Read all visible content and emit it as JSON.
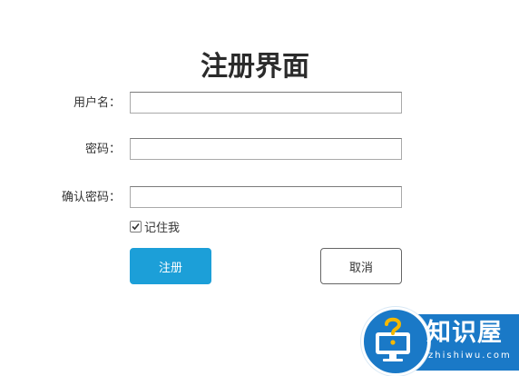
{
  "form": {
    "title": "注册界面",
    "username_label": "用户名：",
    "password_label": "密码：",
    "confirm_label": "确认密码：",
    "username_value": "",
    "password_value": "",
    "confirm_value": "",
    "remember_label": "记住我",
    "remember_checked": true,
    "register_button": "注册",
    "cancel_button": "取消"
  },
  "watermark": {
    "brand": "知识屋",
    "url": "zhishiwu.com",
    "icon": "computer-question-icon"
  },
  "colors": {
    "primary_button": "#1c9fd8",
    "watermark_blue": "#1a79c7",
    "text": "#333333"
  }
}
